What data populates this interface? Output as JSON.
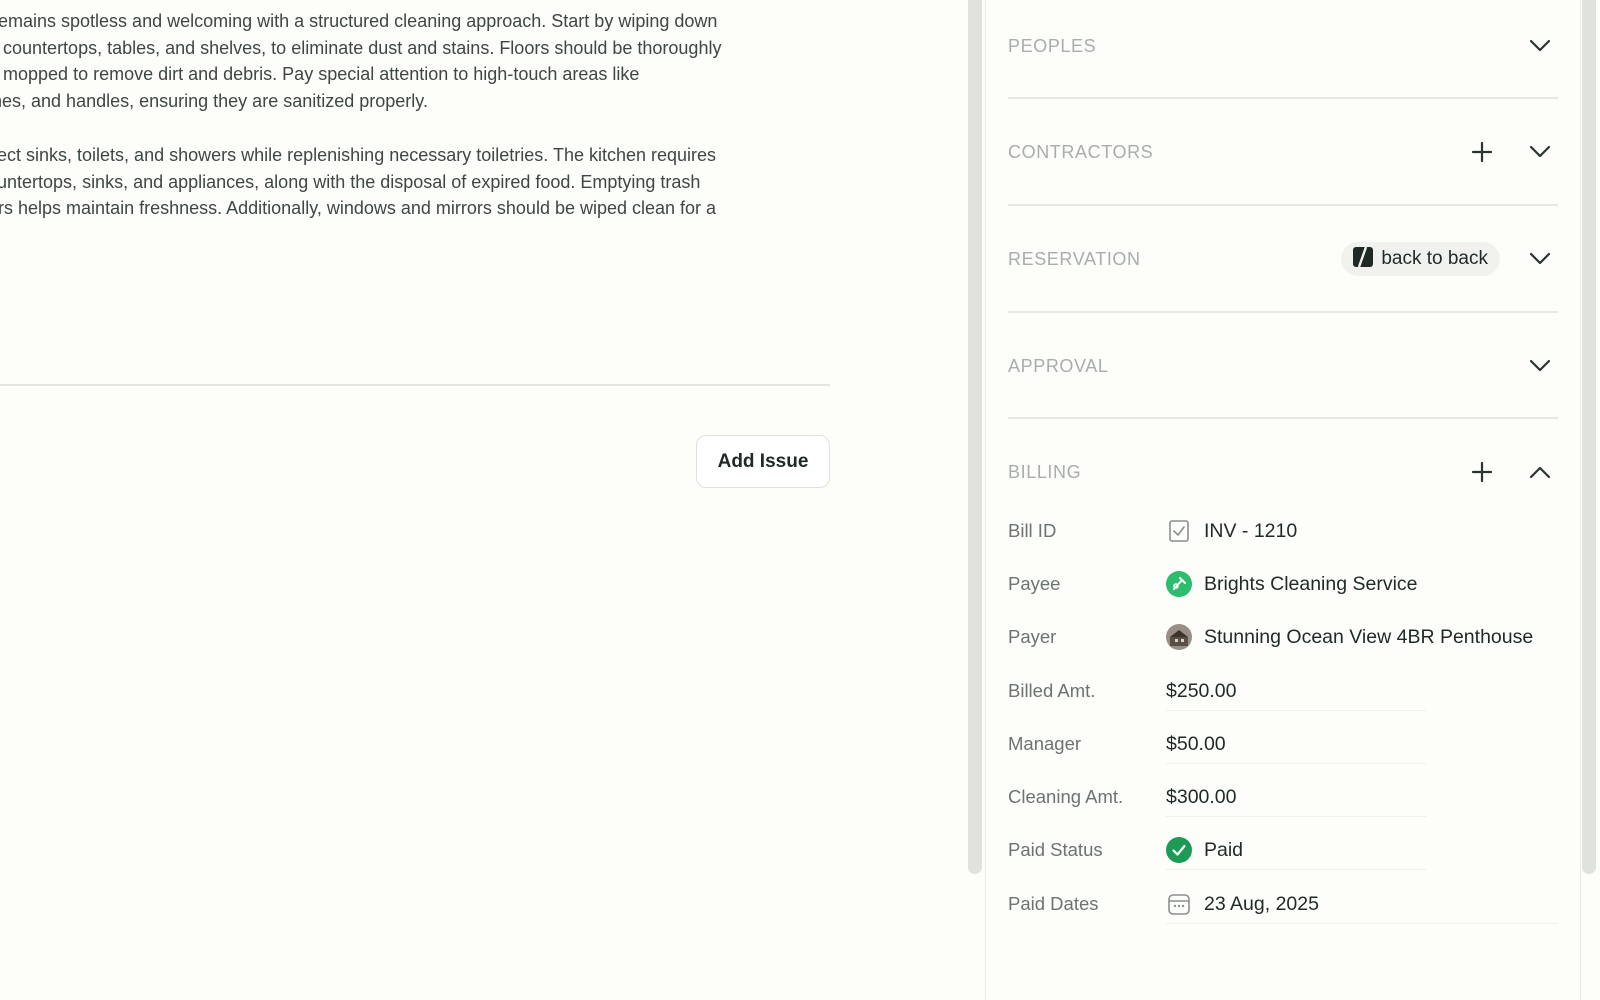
{
  "main": {
    "description_paragraphs": [
      [
        "y remains spotless and welcoming with a structured cleaning approach. Start by wiping down",
        "ng countertops, tables, and shelves, to eliminate dust and stains. Floors should be thoroughly",
        "nd mopped to remove dirt and debris. Pay special attention to high-touch areas like",
        "tches, and handles, ensuring they are sanitized properly."
      ],
      [
        "infect sinks, toilets, and showers while replenishing necessary toiletries. The kitchen requires",
        "countertops, sinks, and appliances, along with the disposal of expired food. Emptying trash",
        "ners helps maintain freshness. Additionally, windows and mirrors should be wiped clean for a"
      ]
    ],
    "add_issue_label": "Add Issue"
  },
  "sections": {
    "peoples": {
      "title": "PEOPLES",
      "icon": "chevron-down-icon"
    },
    "contractors": {
      "title": "CONTRACTORS",
      "icon": "chevron-down-icon",
      "action_icon": "plus-icon"
    },
    "reservation": {
      "title": "RESERVATION",
      "badge": "back to back",
      "badge_icon": "back-to-back-icon",
      "icon": "chevron-down-icon"
    },
    "approval": {
      "title": "APPROVAL",
      "icon": "chevron-down-icon"
    },
    "billing": {
      "title": "BILLING",
      "icon": "chevron-up-icon",
      "action_icon": "plus-icon"
    }
  },
  "billing": {
    "fields": [
      {
        "label": "Bill ID",
        "value": "INV - 1210",
        "icon": "receipt-icon"
      },
      {
        "label": "Payee",
        "value": "Brights Cleaning Service",
        "icon": "cleaning-service-avatar"
      },
      {
        "label": "Payer",
        "value": "Stunning Ocean View 4BR Penthouse",
        "icon": "property-avatar"
      },
      {
        "label": "Billed Amt.",
        "value": "$250.00"
      },
      {
        "label": "Manager",
        "value": "$50.00"
      },
      {
        "label": "Cleaning Amt.",
        "value": "$300.00"
      },
      {
        "label": "Paid Status",
        "value": "Paid",
        "icon": "check-circle-icon"
      },
      {
        "label": "Paid Dates",
        "value": "23 Aug, 2025",
        "icon": "calendar-icon"
      }
    ]
  },
  "colors": {
    "background": "#fdfdfa",
    "section_title": "#a9aeab",
    "label": "#6c7471",
    "text": "#1f2a26",
    "accent_green": "#27ae60",
    "paid_green": "#1e9a57"
  }
}
